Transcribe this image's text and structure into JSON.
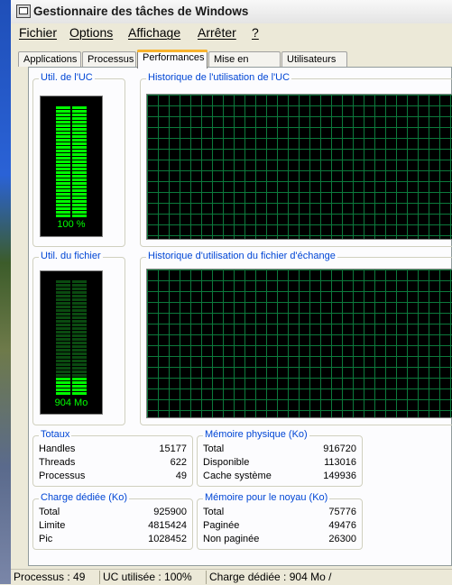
{
  "window": {
    "title": "Gestionnaire des tâches de Windows"
  },
  "menu": [
    "Fichier",
    "Options",
    "Affichage",
    "Arrêter",
    "?"
  ],
  "tabs": [
    "Applications",
    "Processus",
    "Performances",
    "Mise en réseau",
    "Utilisateurs"
  ],
  "active_tab": "Performances",
  "cpu": {
    "label": "Util. de l'UC",
    "value": "100 %",
    "usage_fraction": 1.0
  },
  "cpu_history": {
    "label": "Historique de l'utilisation de l'UC"
  },
  "pagefile": {
    "label": "Util. du fichier",
    "value": "904 Mo",
    "usage_fraction": 0.17
  },
  "pagefile_history": {
    "label": "Historique d'utilisation du fichier d'échange"
  },
  "totaux": {
    "label": "Totaux",
    "rows": [
      {
        "k": "Handles",
        "v": "15177"
      },
      {
        "k": "Threads",
        "v": "622"
      },
      {
        "k": "Processus",
        "v": "49"
      }
    ]
  },
  "memoire_physique": {
    "label": "Mémoire physique (Ko)",
    "rows": [
      {
        "k": "Total",
        "v": "916720"
      },
      {
        "k": "Disponible",
        "v": "113016"
      },
      {
        "k": "Cache système",
        "v": "149936"
      }
    ]
  },
  "charge_dediee": {
    "label": "Charge dédiée (Ko)",
    "rows": [
      {
        "k": "Total",
        "v": "925900"
      },
      {
        "k": "Limite",
        "v": "4815424"
      },
      {
        "k": "Pic",
        "v": "1028452"
      }
    ]
  },
  "memoire_noyau": {
    "label": "Mémoire pour le noyau (Ko)",
    "rows": [
      {
        "k": "Total",
        "v": "75776"
      },
      {
        "k": "Paginée",
        "v": "49476"
      },
      {
        "k": "Non paginée",
        "v": "26300"
      }
    ]
  },
  "statusbar": {
    "processus": "Processus : 49",
    "uc": "UC utilisée : 100%",
    "charge": "Charge dédiée : 904 Mo /"
  },
  "colors": {
    "gauge_on": "#00ff00",
    "gauge_off": "#0a4a10",
    "grid": "#0c7a3c",
    "accent": "#0046d5"
  }
}
